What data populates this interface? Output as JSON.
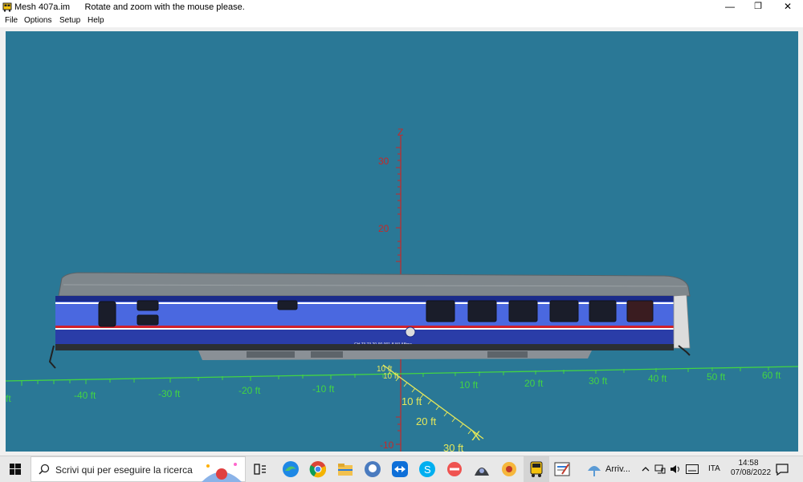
{
  "window": {
    "title": "Mesh 407a.im",
    "hint": "Rotate and zoom with the mouse please.",
    "minimize": "—",
    "maximize": "❐",
    "close": "✕"
  },
  "menu": [
    "File",
    "Options",
    "Setup",
    "Help"
  ],
  "scene": {
    "background": "#2a7896",
    "z_axis": {
      "label": "Z",
      "ticks": [
        "30",
        "20",
        "-10"
      ]
    },
    "y_axis": {
      "ticks": [
        "-40 ft",
        "-30 ft",
        "-20 ft",
        "-10 ft",
        "10 ft",
        "20 ft",
        "30 ft",
        "40 ft",
        "50 ft",
        "60 ft"
      ],
      "left_edge": "ft"
    },
    "x_axis": {
      "label": "X",
      "ticks": [
        "10 ft",
        "20 ft",
        "30 ft"
      ]
    },
    "origin_labels": [
      "10 ft",
      "10 ft"
    ],
    "axis_colors": {
      "z": "#c62828",
      "y": "#43d443",
      "x": "#e6e85a"
    },
    "car": {
      "body": "#4a68e0",
      "roof": "#7f878c",
      "stripe": "#d0202a",
      "train_id": "CH 73 73 20-90.001-8 WLABmz"
    }
  },
  "taskbar": {
    "search_placeholder": "Scrivi qui per eseguire la ricerca",
    "weather": "Arriv...",
    "language": "ITA",
    "time": "14:58",
    "date": "07/08/2022",
    "icons": [
      "windows-start-icon",
      "search-icon",
      "task-view-icon",
      "edge-icon",
      "chrome-icon",
      "file-explorer-icon",
      "github-icon",
      "teamviewer-icon",
      "skype-icon",
      "app-icon",
      "app2-icon",
      "app3-icon",
      "train-sim-icon",
      "editor-icon",
      "weather-icon",
      "notification-icon"
    ]
  }
}
